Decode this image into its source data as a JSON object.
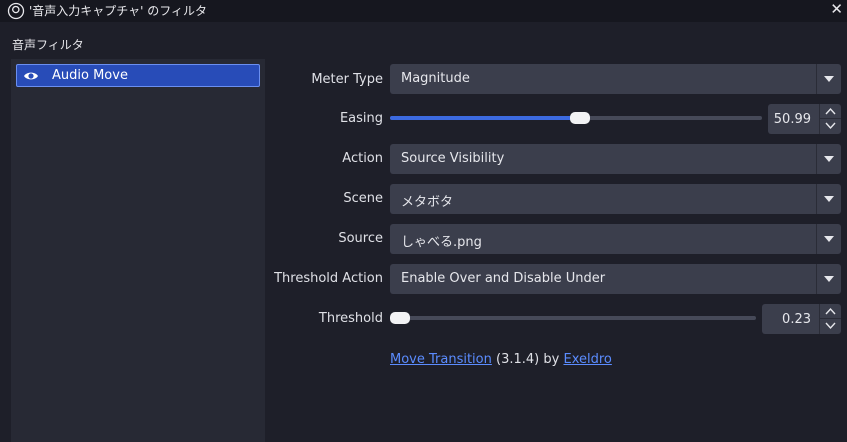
{
  "window": {
    "title": "'音声入力キャプチャ' のフィルタ",
    "close_label": "✕"
  },
  "filters": {
    "section_label": "音声フィルタ",
    "items": [
      {
        "label": "Audio Move",
        "visible": true
      }
    ]
  },
  "properties": {
    "meter_type": {
      "label": "Meter Type",
      "value": "Magnitude"
    },
    "easing": {
      "label": "Easing",
      "value": "50.99",
      "fraction": 0.51
    },
    "action": {
      "label": "Action",
      "value": "Source Visibility"
    },
    "scene": {
      "label": "Scene",
      "value": "メタボタ"
    },
    "source": {
      "label": "Source",
      "value": "しゃべる.png"
    },
    "threshold_action": {
      "label": "Threshold Action",
      "value": "Enable Over and Disable Under"
    },
    "threshold": {
      "label": "Threshold",
      "value": "0.23",
      "fraction": 0.0
    }
  },
  "footer": {
    "plugin_link": "Move Transition",
    "version": "(3.1.4)",
    "by": "by",
    "author_link": "Exeldro"
  },
  "colors": {
    "accent": "#3c6ae0",
    "selection": "#284cb8",
    "link": "#5b8cff"
  }
}
